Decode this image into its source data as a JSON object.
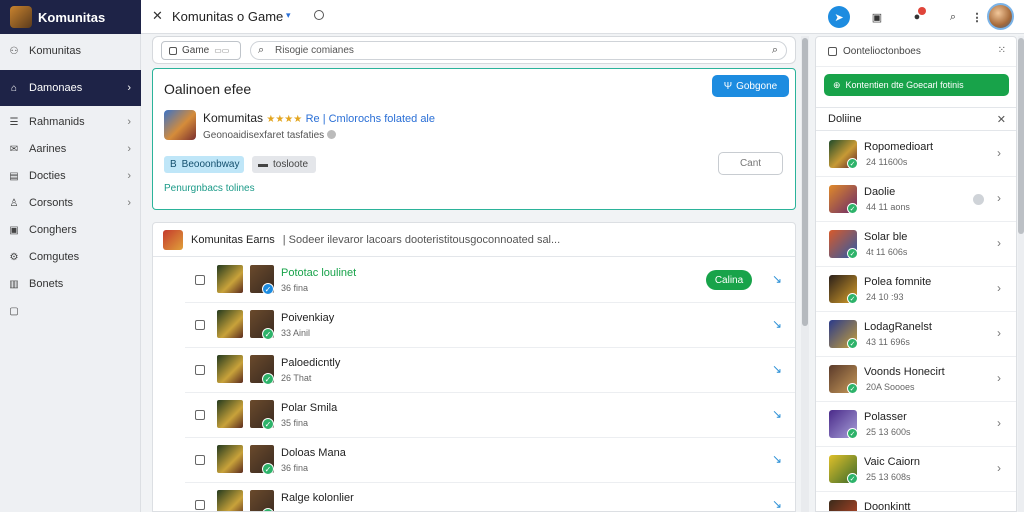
{
  "app": {
    "name": "Komunitas"
  },
  "tab": {
    "title": "Komunitas o Game",
    "close": "✕",
    "chevron": "▾"
  },
  "topbar": {
    "more": "⋮"
  },
  "sidebar": {
    "items": [
      {
        "label": "Komunitas",
        "icon": "people-icon",
        "glyph": "⚇",
        "chevron": ""
      },
      {
        "label": "Damonaes",
        "icon": "home-icon",
        "glyph": "⌂",
        "chevron": "›",
        "active": true
      },
      {
        "label": "Rahmanids",
        "icon": "list-icon",
        "glyph": "☰",
        "chevron": "›"
      },
      {
        "label": "Aarines",
        "icon": "mail-icon",
        "glyph": "✉",
        "chevron": "›"
      },
      {
        "label": "Docties",
        "icon": "doc-icon",
        "glyph": "▤",
        "chevron": "›"
      },
      {
        "label": "Corsonts",
        "icon": "user-icon",
        "glyph": "♙",
        "chevron": "›"
      },
      {
        "label": "Conghers",
        "icon": "bag-icon",
        "glyph": "▣",
        "chevron": ""
      },
      {
        "label": "Comgutes",
        "icon": "gear-icon",
        "glyph": "⚙",
        "chevron": ""
      },
      {
        "label": "Bonets",
        "icon": "book-icon",
        "glyph": "▥",
        "chevron": ""
      },
      {
        "label": "",
        "icon": "message-icon",
        "glyph": "▢",
        "chevron": ""
      }
    ]
  },
  "search": {
    "game_chip": "Game",
    "chip_chevron": "▭▭",
    "text": "Risogie comianes",
    "icon_left": "⌕",
    "icon_right": "⌕"
  },
  "panel": {
    "title": "Oalinoen efee",
    "button": "Gobgone",
    "button_glyph": "Ψ",
    "game_name": "Komumitas",
    "stars": "★★★★",
    "meta": "Re | Cmlorochs folated ale",
    "sub": "Geonoaidisexfaret tasfaties",
    "chip1": "Beooonbway",
    "chip1_glyph": "B",
    "chip2": "tosloote",
    "chip2_glyph": "▬",
    "link": "Penurgnbacs tolines",
    "cancel": "Cant"
  },
  "list": {
    "head_title": "Komunitas Earns",
    "head_desc": "| Sodeer ilevaror lacoars dooteristitousgoconnoated sal...",
    "rows": [
      {
        "name": "Pototac loulinet",
        "sub": "36 fina",
        "pill": "Calina",
        "green": true,
        "chk": "blue"
      },
      {
        "name": "Poivenkiay",
        "sub": "33 Ainil",
        "pill": "",
        "green": false,
        "chk": "green"
      },
      {
        "name": "Paloedicntly",
        "sub": "26 That",
        "pill": "",
        "green": false,
        "chk": "green"
      },
      {
        "name": "Polar Smila",
        "sub": "35 fina",
        "pill": "",
        "green": false,
        "chk": "green"
      },
      {
        "name": "Doloas Mana",
        "sub": "36 fina",
        "pill": "",
        "green": false,
        "chk": "green"
      },
      {
        "name": "Ralge kolonlier",
        "sub": "",
        "pill": "",
        "green": false,
        "chk": "green"
      }
    ],
    "go": "↘"
  },
  "rpanel": {
    "head": "Oontelioctonboes",
    "grid": "⁙",
    "button": "Kontentien dte Goecarl fotinis",
    "button_glyph": "⊕",
    "section": "Doliine",
    "close": "✕",
    "items": [
      {
        "name": "Ropomedioart",
        "sub": "24 11600s",
        "clock": false,
        "thumb": "linear-gradient(135deg,#1f4a2a,#c79a35 55%,#5c1f2a)"
      },
      {
        "name": "Daolie",
        "sub": "44 11 aons",
        "clock": true,
        "thumb": "linear-gradient(135deg,#e08a2a,#6a2a6a)"
      },
      {
        "name": "Solar ble",
        "sub": "4t 11 606s",
        "clock": false,
        "thumb": "linear-gradient(135deg,#d85a2a,#2a5aa8)"
      },
      {
        "name": "Polea fomnite",
        "sub": "24 10 :93",
        "clock": false,
        "thumb": "linear-gradient(135deg,#2a1f1a,#d8a02a)"
      },
      {
        "name": "LodagRanelst",
        "sub": "43 11 696s",
        "clock": false,
        "thumb": "linear-gradient(135deg,#2a3a8a,#c8a23a)"
      },
      {
        "name": "Voonds Honecirt",
        "sub": "20A Soooes",
        "clock": false,
        "thumb": "linear-gradient(135deg,#5a3a2a,#c89a5a)"
      },
      {
        "name": "Polasser",
        "sub": "25 13 600s",
        "clock": false,
        "thumb": "linear-gradient(135deg,#4a2a8a,#a8a0d8)"
      },
      {
        "name": "Vaic Caiorn",
        "sub": "25 13 608s",
        "clock": false,
        "thumb": "linear-gradient(135deg,#e0c02a,#3a6a2a)"
      },
      {
        "name": "Doonkintt",
        "sub": "",
        "clock": false,
        "thumb": "linear-gradient(135deg,#3a2a1a,#c84a2a)"
      }
    ],
    "go": "›"
  }
}
